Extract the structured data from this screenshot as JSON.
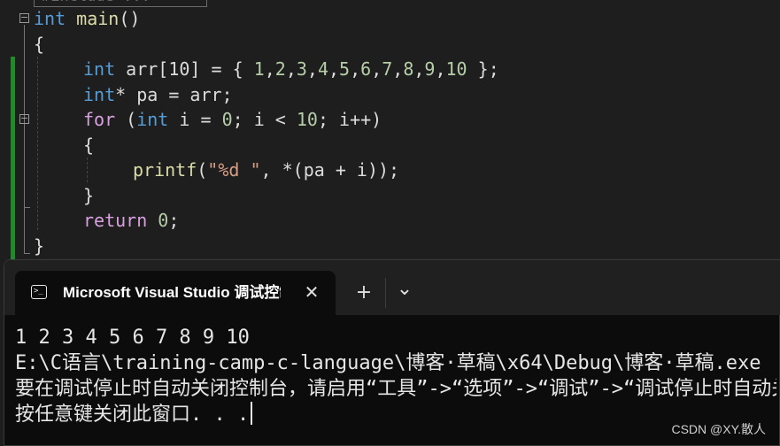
{
  "editor": {
    "collapsed_include": "#include ...",
    "lines": [
      {
        "tokens": [
          [
            "kw",
            "int"
          ],
          [
            "sp",
            " "
          ],
          [
            "fn",
            "main"
          ],
          [
            "txt",
            "()"
          ]
        ]
      },
      {
        "tokens": [
          [
            "txt",
            "{"
          ]
        ]
      },
      {
        "tokens": [
          [
            "kw",
            "int"
          ],
          [
            "sp",
            " "
          ],
          [
            "txt",
            "arr[10] = { "
          ],
          [
            "num",
            "1"
          ],
          [
            "txt",
            ","
          ],
          [
            "num",
            "2"
          ],
          [
            "txt",
            ","
          ],
          [
            "num",
            "3"
          ],
          [
            "txt",
            ","
          ],
          [
            "num",
            "4"
          ],
          [
            "txt",
            ","
          ],
          [
            "num",
            "5"
          ],
          [
            "txt",
            ","
          ],
          [
            "num",
            "6"
          ],
          [
            "txt",
            ","
          ],
          [
            "num",
            "7"
          ],
          [
            "txt",
            ","
          ],
          [
            "num",
            "8"
          ],
          [
            "txt",
            ","
          ],
          [
            "num",
            "9"
          ],
          [
            "txt",
            ","
          ],
          [
            "num",
            "10"
          ],
          [
            "txt",
            " };"
          ]
        ]
      },
      {
        "tokens": [
          [
            "kw",
            "int"
          ],
          [
            "txt",
            "* pa = arr;"
          ]
        ]
      },
      {
        "tokens": [
          [
            "ctrl",
            "for"
          ],
          [
            "txt",
            " ("
          ],
          [
            "kw",
            "int"
          ],
          [
            "txt",
            " i = "
          ],
          [
            "num",
            "0"
          ],
          [
            "txt",
            "; i < "
          ],
          [
            "num",
            "10"
          ],
          [
            "txt",
            "; i++)"
          ]
        ]
      },
      {
        "tokens": [
          [
            "txt",
            "{"
          ]
        ]
      },
      {
        "tokens": [
          [
            "fn",
            "printf"
          ],
          [
            "txt",
            "("
          ],
          [
            "str",
            "\""
          ],
          [
            "fmt",
            "%d"
          ],
          [
            "str",
            " \""
          ],
          [
            "txt",
            ", *(pa + i));"
          ]
        ]
      },
      {
        "tokens": [
          [
            "txt",
            "}"
          ]
        ]
      },
      {
        "tokens": [
          [
            "ctrl",
            "return"
          ],
          [
            "txt",
            " "
          ],
          [
            "num",
            "0"
          ],
          [
            "txt",
            ";"
          ]
        ]
      },
      {
        "tokens": [
          [
            "txt",
            "}"
          ]
        ]
      }
    ]
  },
  "terminal": {
    "tab_title": "Microsoft Visual Studio 调试控制台",
    "new_tab_label": "+",
    "dropdown_label": "⌄",
    "close_label": "✕",
    "output": [
      "1 2 3 4 5 6 7 8 9 10",
      "E:\\C语言\\training-camp-c-language\\博客·草稿\\x64\\Debug\\博客·草稿.exe",
      "要在调试停止时自动关闭控制台，请启用“工具”->“选项”->“调试”->“调试停止时自动关闭控制台”。",
      "按任意键关闭此窗口. . ."
    ]
  },
  "watermark": "CSDN @XY.散人"
}
